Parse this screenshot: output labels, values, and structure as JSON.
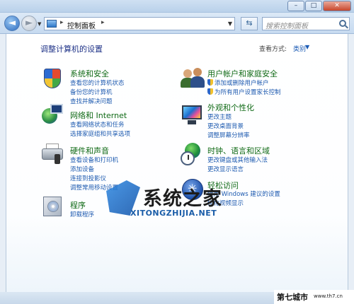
{
  "window": {
    "minimize_glyph": "–",
    "maximize_glyph": "□",
    "close_glyph": "✕"
  },
  "nav": {
    "back_glyph": "◄",
    "forward_glyph": "►",
    "address_text": "控制面板",
    "refresh_glyph": "⇆",
    "search_placeholder": "搜索控制面板"
  },
  "header": {
    "title": "调整计算机的设置",
    "view_by_label": "查看方式:",
    "view_by_value": "类别"
  },
  "categories": [
    {
      "title": "系统和安全",
      "icon": "shield-icon",
      "links": [
        "查看您的计算机状态",
        "备份您的计算机",
        "查找并解决问题"
      ]
    },
    {
      "title": "网络和 Internet",
      "icon": "network-globe-icon",
      "links": [
        "查看网络状态和任务",
        "选择家庭组和共享选项"
      ]
    },
    {
      "title": "硬件和声音",
      "icon": "printer-icon",
      "links": [
        "查看设备和打印机",
        "添加设备",
        "连接到投影仪",
        "调整常用移动设置"
      ]
    },
    {
      "title": "程序",
      "icon": "programs-disc-icon",
      "links": [
        "卸载程序"
      ]
    },
    {
      "title": "用户帐户和家庭安全",
      "icon": "users-icon",
      "links": [
        "添加或删除用户帐户",
        "为所有用户设置家长控制"
      ]
    },
    {
      "title": "外观和个性化",
      "icon": "monitor-icon",
      "links": [
        "更改主题",
        "更改桌面背景",
        "调整屏幕分辨率"
      ]
    },
    {
      "title": "时钟、语言和区域",
      "icon": "clock-globe-icon",
      "links": [
        "更改键盘或其他输入法",
        "更改显示语言"
      ]
    },
    {
      "title": "轻松访问",
      "icon": "ease-of-access-icon",
      "links": [
        "使用 Windows 建议的设置",
        "优化视频显示"
      ]
    }
  ],
  "watermark": {
    "title": "系统之家",
    "domain": "XITONGZHIJIA.NET",
    "corner_text": "第七城市",
    "corner_domain": "www.th7.cn"
  }
}
